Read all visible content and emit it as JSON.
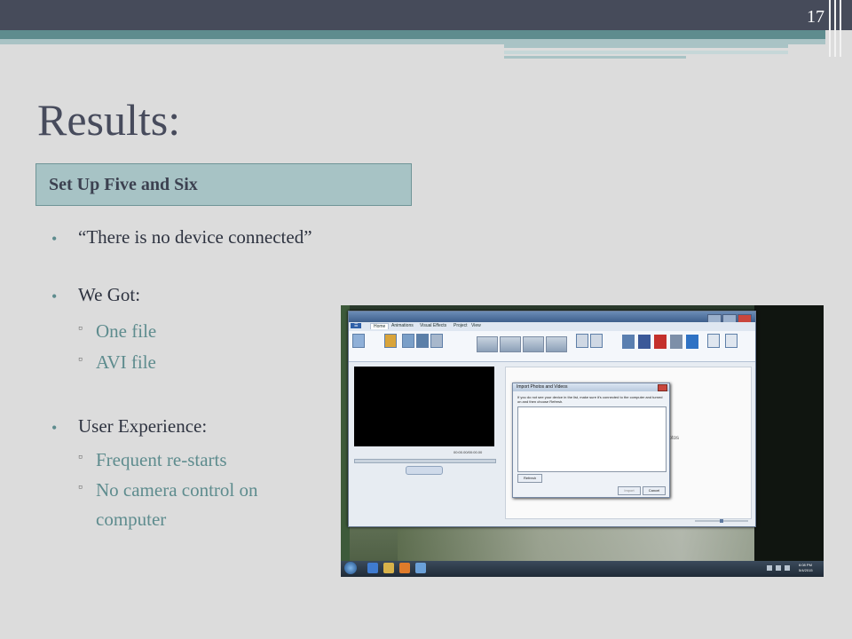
{
  "slide": {
    "number": "17",
    "title": "Results:",
    "subtitle": "Set Up Five and Six"
  },
  "bullets": {
    "item1": "“There is no device connected”",
    "item2": "We Got:",
    "item2_sub": [
      "One file",
      "AVI file"
    ],
    "item3": "User Experience:",
    "item3_sub1": "Frequent re-starts",
    "item3_sub2_line1": "No camera control on",
    "item3_sub2_line2": "computer"
  },
  "screenshot": {
    "ribbon_tabs": [
      "Home",
      "Animations",
      "Visual Effects",
      "Project",
      "View"
    ],
    "dialog_title": "Import Photos and Videos",
    "dialog_message": "If you do not see your device in the list, make sure it's connected to the computer and turned on and then choose Refresh.",
    "refresh_label": "Refresh",
    "import_label": "Import",
    "cancel_label": "Cancel",
    "timecode": "00:00.00/00:00.00",
    "storyboard_hint": "photos",
    "clock_time": "6:08 PM",
    "clock_date": "5/4/2015"
  },
  "colors": {
    "accent_teal": "#5e8c8e",
    "title_color": "#474b5c",
    "band_dark": "#464b5a",
    "subtitle_bg": "#a7c3c5"
  }
}
